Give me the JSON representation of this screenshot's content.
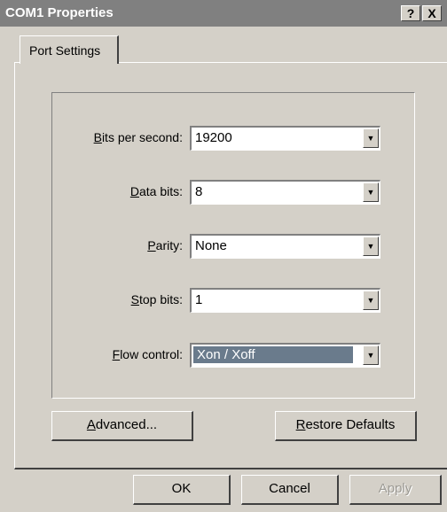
{
  "window": {
    "title": "COM1 Properties",
    "help_label": "?",
    "close_label": "X"
  },
  "tabs": [
    {
      "label": "Port Settings"
    }
  ],
  "port_settings": {
    "bits_per_second": {
      "label_mnemonic": "B",
      "label_rest": "its per second:",
      "value": "19200"
    },
    "data_bits": {
      "label_mnemonic": "D",
      "label_rest": "ata bits:",
      "value": "8"
    },
    "parity": {
      "label_mnemonic": "P",
      "label_rest": "arity:",
      "value": "None"
    },
    "stop_bits": {
      "label_mnemonic": "S",
      "label_rest": "top bits:",
      "value": "1"
    },
    "flow_control": {
      "label_mnemonic": "F",
      "label_rest": "low control:",
      "value": "Xon / Xoff"
    },
    "advanced": {
      "mnemonic": "A",
      "rest": "dvanced..."
    },
    "restore_defaults": {
      "mnemonic": "R",
      "rest": "estore Defaults"
    }
  },
  "dialog_buttons": {
    "ok": "OK",
    "cancel": "Cancel",
    "apply": "Apply"
  }
}
